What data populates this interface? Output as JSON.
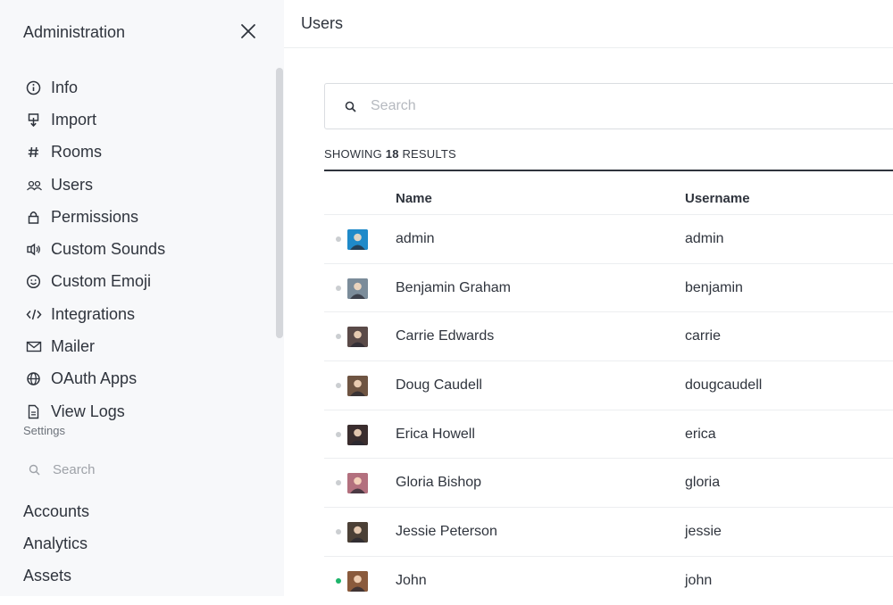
{
  "sidebar": {
    "title": "Administration",
    "items": [
      {
        "label": "Info",
        "icon": "info-icon"
      },
      {
        "label": "Import",
        "icon": "import-icon"
      },
      {
        "label": "Rooms",
        "icon": "hashtag-icon"
      },
      {
        "label": "Users",
        "icon": "users-icon"
      },
      {
        "label": "Permissions",
        "icon": "lock-icon"
      },
      {
        "label": "Custom Sounds",
        "icon": "sound-icon"
      },
      {
        "label": "Custom Emoji",
        "icon": "emoji-icon"
      },
      {
        "label": "Integrations",
        "icon": "code-icon"
      },
      {
        "label": "Mailer",
        "icon": "mail-icon"
      },
      {
        "label": "OAuth Apps",
        "icon": "globe-icon"
      },
      {
        "label": "View Logs",
        "icon": "file-icon"
      }
    ],
    "settings_label": "Settings",
    "settings_search_placeholder": "Search",
    "settings_items": [
      "Accounts",
      "Analytics",
      "Assets"
    ]
  },
  "main": {
    "title": "Users",
    "search_placeholder": "Search",
    "results_prefix": "SHOWING ",
    "results_count": "18",
    "results_suffix": " RESULTS",
    "columns": {
      "name": "Name",
      "username": "Username"
    },
    "rows": [
      {
        "name": "admin",
        "username": "admin",
        "status": "offline",
        "avatar_color": "#1f8ac9"
      },
      {
        "name": "Benjamin Graham",
        "username": "benjamin",
        "status": "offline",
        "avatar_color": "#7b8c9a"
      },
      {
        "name": "Carrie Edwards",
        "username": "carrie",
        "status": "offline",
        "avatar_color": "#5a4a48"
      },
      {
        "name": "Doug Caudell",
        "username": "dougcaudell",
        "status": "offline",
        "avatar_color": "#6e5442"
      },
      {
        "name": "Erica Howell",
        "username": "erica",
        "status": "offline",
        "avatar_color": "#3a2d2e"
      },
      {
        "name": "Gloria Bishop",
        "username": "gloria",
        "status": "offline",
        "avatar_color": "#b3707e"
      },
      {
        "name": "Jessie Peterson",
        "username": "jessie",
        "status": "offline",
        "avatar_color": "#4b4036"
      },
      {
        "name": "John",
        "username": "john",
        "status": "online",
        "avatar_color": "#8a5a3c"
      }
    ]
  },
  "colors": {
    "sidebar_bg": "#f7f8fa",
    "text": "#2f343d",
    "muted": "#9ea2a8",
    "online": "#1db46b",
    "offline": "#cbced1"
  }
}
